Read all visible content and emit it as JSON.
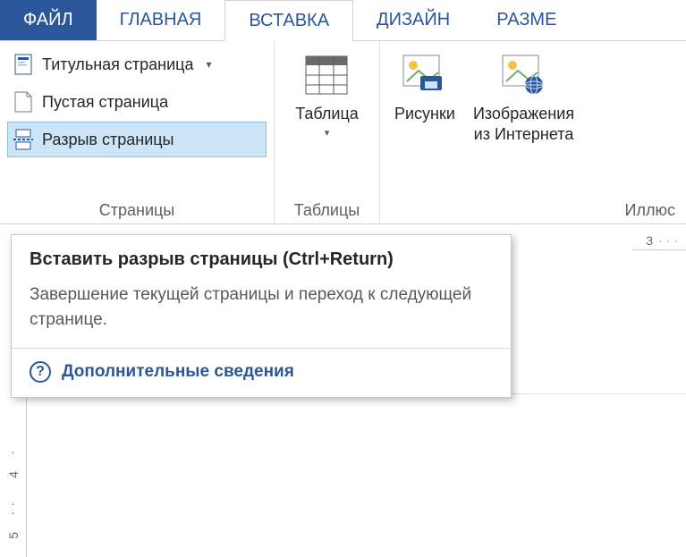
{
  "tabs": {
    "file": "ФАЙЛ",
    "home": "ГЛАВНАЯ",
    "insert": "ВСТАВКА",
    "design": "ДИЗАЙН",
    "layout": "РАЗМЕ"
  },
  "groups": {
    "pages": {
      "label": "Страницы",
      "cover_page": "Титульная страница",
      "blank_page": "Пустая страница",
      "page_break": "Разрыв страницы"
    },
    "tables": {
      "label": "Таблицы",
      "table": "Таблица"
    },
    "illustrations": {
      "label": "Иллюс",
      "pictures": "Рисунки",
      "online_pictures_l1": "Изображения",
      "online_pictures_l2": "из Интернета"
    }
  },
  "tooltip": {
    "title": "Вставить разрыв страницы (Ctrl+Return)",
    "description": "Завершение текущей страницы и переход к следующей странице.",
    "more": "Дополнительные сведения"
  },
  "ruler": {
    "h_marks": [
      "3"
    ],
    "v_marks": [
      "4",
      "5"
    ]
  }
}
